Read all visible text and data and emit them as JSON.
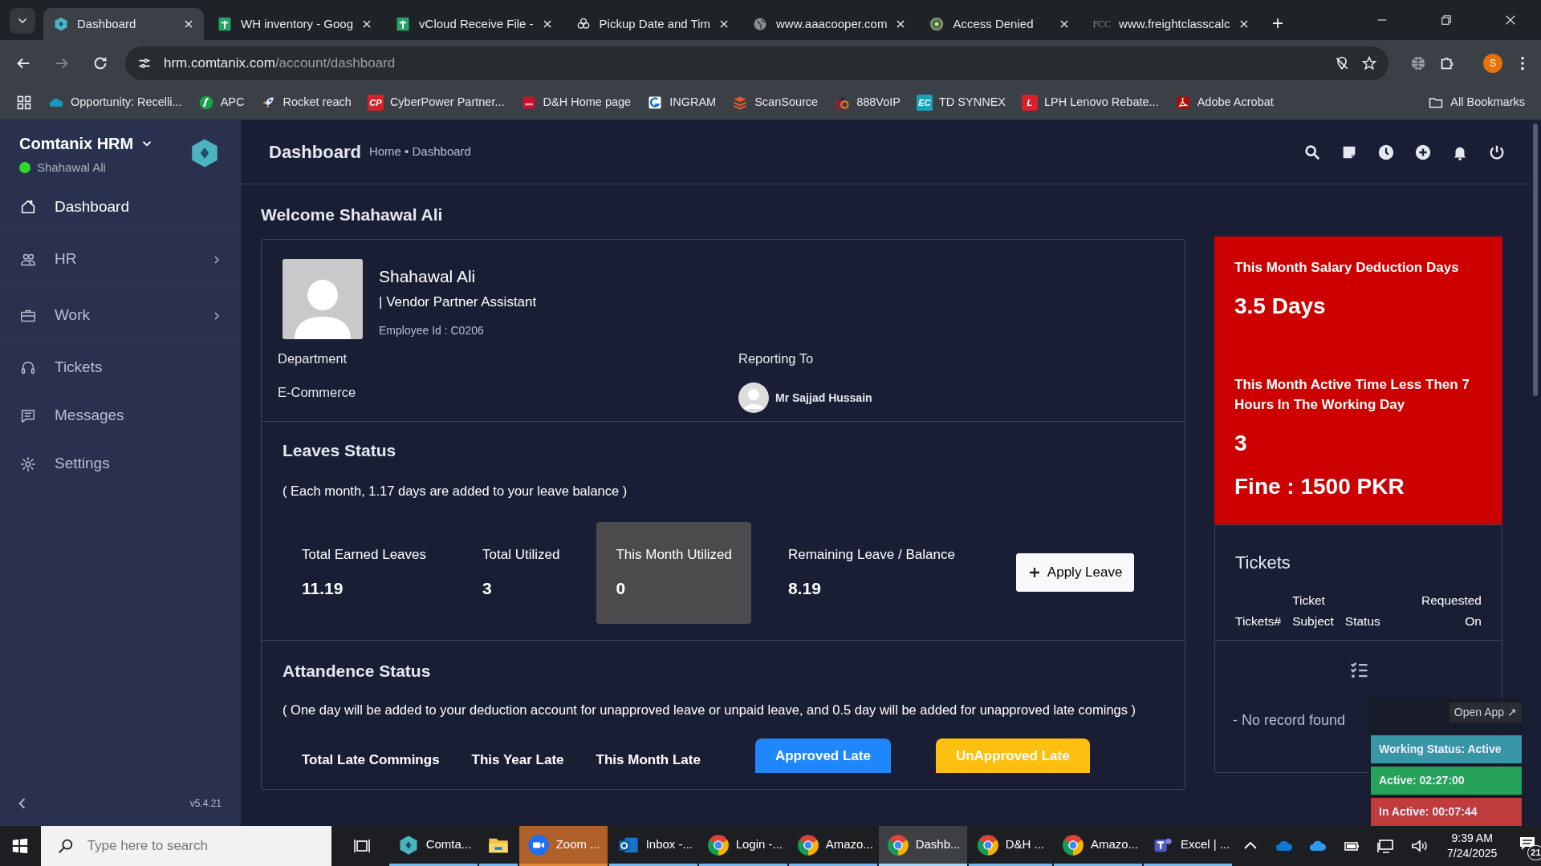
{
  "browser": {
    "tabs": [
      {
        "title": "Dashboard",
        "kind": "hexagon",
        "selected": true
      },
      {
        "title": "WH inventory - Goog",
        "kind": "sheets",
        "selected": false
      },
      {
        "title": "vCloud Receive File -",
        "kind": "sheets",
        "selected": false
      },
      {
        "title": "Pickup Date and Tim",
        "kind": "knot",
        "selected": false
      },
      {
        "title": "www.aaacooper.com",
        "kind": "globe",
        "selected": false
      },
      {
        "title": "Access Denied",
        "kind": "seal",
        "selected": false
      },
      {
        "title": "www.freightclasscalc",
        "kind": "text",
        "icon_text": "FCC",
        "selected": false
      }
    ],
    "url_host": "hrm.comtanix.com",
    "url_path": "/account/dashboard",
    "profile_initial": "S",
    "bookmarks": [
      {
        "label": "Opportunity: Recelli...",
        "kind": "cloud"
      },
      {
        "label": "APC",
        "kind": "apc"
      },
      {
        "label": "Rocket reach",
        "kind": "rocket"
      },
      {
        "label": "CyberPower Partner...",
        "kind": "letters",
        "icon_text": "CP",
        "color": "#d3222a"
      },
      {
        "label": "D&H Home page",
        "kind": "dh"
      },
      {
        "label": "INGRAM",
        "kind": "ingram"
      },
      {
        "label": "ScanSource",
        "kind": "stack"
      },
      {
        "label": "888VoIP",
        "kind": "rings"
      },
      {
        "label": "TD SYNNEX",
        "kind": "letters",
        "icon_text": "EC",
        "color": "#19a3b8"
      },
      {
        "label": "LPH Lenovo Rebate...",
        "kind": "letters",
        "icon_text": "L",
        "color": "#d3222a"
      },
      {
        "label": "Adobe Acrobat",
        "kind": "pdf"
      }
    ],
    "all_bookmarks": "All Bookmarks"
  },
  "app": {
    "brand": "Comtanix HRM",
    "user": "Shahawal Ali",
    "online": true,
    "version": "v5.4.21",
    "nav": [
      {
        "label": "Dashboard",
        "kind": "home",
        "selected": true,
        "has_children": false
      },
      {
        "label": "HR",
        "kind": "people",
        "selected": false,
        "has_children": true
      },
      {
        "label": "Work",
        "kind": "briefcase",
        "selected": false,
        "has_children": true
      },
      {
        "label": "Tickets",
        "kind": "headset",
        "selected": false,
        "has_children": false
      },
      {
        "label": "Messages",
        "kind": "chat",
        "selected": false,
        "has_children": false
      },
      {
        "label": "Settings",
        "kind": "gear",
        "selected": false,
        "has_children": false
      }
    ]
  },
  "header": {
    "title": "Dashboard",
    "breadcrumb": "Home • Dashboard"
  },
  "welcome": "Welcome Shahawal Ali",
  "profile": {
    "name": "Shahawal Ali",
    "role": "| Vendor Partner Assistant",
    "employee_id": "Employee Id : C0206",
    "department_label": "Department",
    "department": "E-Commerce",
    "reporting_label": "Reporting To",
    "manager": "Mr Sajjad Hussain"
  },
  "leaves": {
    "title": "Leaves Status",
    "note": "( Each month, 1.17 days are added to your leave balance )",
    "stats": [
      {
        "label": "Total Earned Leaves",
        "value": "11.19",
        "highlighted": false
      },
      {
        "label": "Total Utilized",
        "value": "3",
        "highlighted": false
      },
      {
        "label": "This Month Utilized",
        "value": "0",
        "highlighted": true
      },
      {
        "label": "Remaining Leave / Balance",
        "value": "8.19",
        "highlighted": false
      }
    ],
    "apply_button": "Apply Leave"
  },
  "attendance": {
    "title": "Attandence Status",
    "note": "( One day will be added to your deduction account for unapproved leave or unpaid leave, and 0.5 day will be added for unapproved late comings )",
    "stats": [
      {
        "label": "Total Late Commings"
      },
      {
        "label": "This Year Late"
      },
      {
        "label": "This Month Late"
      }
    ],
    "buttons": [
      {
        "label": "Approved Late",
        "color": "#1f87fb"
      },
      {
        "label": "UnApproved Late",
        "color": "#fdc010"
      }
    ]
  },
  "deductions": [
    {
      "label": "This Month Salary Deduction Days",
      "value": "3.5 Days"
    },
    {
      "label": "This Month Active Time Less Then 7 Hours In The Working Day",
      "value": "3",
      "fine": "Fine : 1500 PKR"
    }
  ],
  "tickets": {
    "title": "Tickets",
    "columns": [
      [
        "Tickets#"
      ],
      [
        "Ticket",
        "Subject"
      ],
      [
        "Status"
      ],
      [
        "Requested",
        "On"
      ]
    ],
    "empty": "- No record found"
  },
  "tracker": {
    "open_app": "Open App ↗",
    "rows": [
      {
        "text": "Working Status: Active",
        "kind": "status"
      },
      {
        "text": "Active: 02:27:00",
        "kind": "active"
      },
      {
        "text": "In Active: 00:07:44",
        "kind": "inactive"
      }
    ]
  },
  "taskbar": {
    "search_placeholder": "Type here to search",
    "apps": [
      {
        "label": "Comta...",
        "kind": "hexagon",
        "selected": false,
        "flashing": false
      },
      {
        "kind": "folder",
        "selected": false,
        "flashing": false
      },
      {
        "label": "Zoom ...",
        "kind": "zoom",
        "selected": false,
        "flashing": true
      },
      {
        "label": "Inbox -...",
        "kind": "outlook",
        "selected": false,
        "flashing": false
      },
      {
        "label": "Login -...",
        "kind": "chrome",
        "selected": false,
        "flashing": false
      },
      {
        "label": "Amazo...",
        "kind": "chrome",
        "selected": false,
        "flashing": false
      },
      {
        "label": "Dashb...",
        "kind": "chrome",
        "selected": true,
        "flashing": false
      },
      {
        "label": "D&H ...",
        "kind": "chrome",
        "selected": false,
        "flashing": false
      },
      {
        "label": "Amazo...",
        "kind": "chrome",
        "selected": false,
        "flashing": false
      },
      {
        "label": "Excel | ...",
        "kind": "teams",
        "selected": false,
        "flashing": false
      }
    ],
    "time": "9:39 AM",
    "date": "7/24/2025",
    "notifications": "21"
  }
}
